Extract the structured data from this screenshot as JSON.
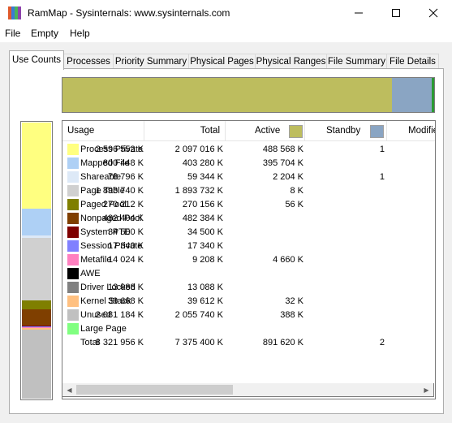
{
  "window": {
    "title": "RamMap - Sysinternals: www.sysinternals.com",
    "icon_colors": [
      "#e05a2b",
      "#3a7bd5",
      "#49b35a",
      "#8e44ad"
    ],
    "controls": {
      "minimize": "minimize-icon",
      "maximize": "maximize-icon",
      "close": "close-icon"
    }
  },
  "menu": [
    "File",
    "Empty",
    "Help"
  ],
  "tabs": [
    {
      "label": "Use Counts",
      "active": true
    },
    {
      "label": "Processes"
    },
    {
      "label": "Priority Summary"
    },
    {
      "label": "Physical Pages"
    },
    {
      "label": "Physical Ranges"
    },
    {
      "label": "File Summary"
    },
    {
      "label": "File Details"
    }
  ],
  "top_bar": {
    "segments": [
      {
        "name": "Active",
        "fraction": 0.886,
        "color": "#bdbd5e"
      },
      {
        "name": "Standby",
        "fraction": 0.107,
        "color": "#8aa5c3"
      },
      {
        "name": "Modified",
        "fraction": 0.007,
        "color": "#2a9a32"
      }
    ]
  },
  "vertical_bar": {
    "segments": [
      {
        "name": "Process Private",
        "fraction": 0.312,
        "color": "#ffff80"
      },
      {
        "name": "Mapped File",
        "fraction": 0.096,
        "color": "#aed0f5"
      },
      {
        "name": "Shareable",
        "fraction": 0.009,
        "color": "#dde9f7"
      },
      {
        "name": "Page Table",
        "fraction": 0.228,
        "color": "#d0d0d0"
      },
      {
        "name": "Paged Pool",
        "fraction": 0.032,
        "color": "#7f7f00"
      },
      {
        "name": "Nonpaged Pool",
        "fraction": 0.058,
        "color": "#7f3f00"
      },
      {
        "name": "System PTE",
        "fraction": 0.004,
        "color": "#7f0000"
      },
      {
        "name": "Session Private",
        "fraction": 0.002,
        "color": "#8080ff"
      },
      {
        "name": "Metafile",
        "fraction": 0.002,
        "color": "#ff80c0"
      },
      {
        "name": "Driver Locked",
        "fraction": 0.002,
        "color": "#808080"
      },
      {
        "name": "Kernel Stack",
        "fraction": 0.005,
        "color": "#ffc080"
      },
      {
        "name": "Unused",
        "fraction": 0.25,
        "color": "#c0c0c0"
      }
    ]
  },
  "table": {
    "headers": {
      "usage": "Usage",
      "total": "Total",
      "active": "Active",
      "standby": "Standby",
      "modified": "Modifie"
    },
    "header_swatches": {
      "active": "#bdbd5e",
      "standby": "#8aa5c3"
    },
    "rows": [
      {
        "label": "Process Private",
        "color": "#ffff80",
        "total": "2 596 552 K",
        "active": "2 097 016 K",
        "standby": "488 568 K",
        "modified": "1"
      },
      {
        "label": "Mapped File",
        "color": "#aed0f5",
        "total": "800 448 K",
        "active": "403 280 K",
        "standby": "395 704 K",
        "modified": ""
      },
      {
        "label": "Shareable",
        "color": "#dde9f7",
        "total": "78 796 K",
        "active": "59 344 K",
        "standby": "2 204 K",
        "modified": "1"
      },
      {
        "label": "Page Table",
        "color": "#d0d0d0",
        "total": "1 893 740 K",
        "active": "1 893 732 K",
        "standby": "8 K",
        "modified": ""
      },
      {
        "label": "Paged Pool",
        "color": "#7f7f00",
        "total": "270 212 K",
        "active": "270 156 K",
        "standby": "56 K",
        "modified": ""
      },
      {
        "label": "Nonpaged Pool",
        "color": "#7f3f00",
        "total": "482 404 K",
        "active": "482 384 K",
        "standby": "",
        "modified": ""
      },
      {
        "label": "System PTE",
        "color": "#7f0000",
        "total": "34 500 K",
        "active": "34 500 K",
        "standby": "",
        "modified": ""
      },
      {
        "label": "Session Private",
        "color": "#8080ff",
        "total": "17 340 K",
        "active": "17 340 K",
        "standby": "",
        "modified": ""
      },
      {
        "label": "Metafile",
        "color": "#ff80c0",
        "total": "14 024 K",
        "active": "9 208 K",
        "standby": "4 660 K",
        "modified": ""
      },
      {
        "label": "AWE",
        "color": "#000000",
        "total": "",
        "active": "",
        "standby": "",
        "modified": ""
      },
      {
        "label": "Driver Locked",
        "color": "#808080",
        "total": "13 088 K",
        "active": "13 088 K",
        "standby": "",
        "modified": ""
      },
      {
        "label": "Kernel Stack",
        "color": "#ffc080",
        "total": "39 668 K",
        "active": "39 612 K",
        "standby": "32 K",
        "modified": ""
      },
      {
        "label": "Unused",
        "color": "#c0c0c0",
        "total": "2 081 184 K",
        "active": "2 055 740 K",
        "standby": "388 K",
        "modified": ""
      },
      {
        "label": "Large Page",
        "color": "#80ff80",
        "total": "",
        "active": "",
        "standby": "",
        "modified": ""
      },
      {
        "label": "Total",
        "color": "",
        "total": "8 321 956 K",
        "active": "7 375 400 K",
        "standby": "891 620 K",
        "modified": "2"
      }
    ]
  }
}
